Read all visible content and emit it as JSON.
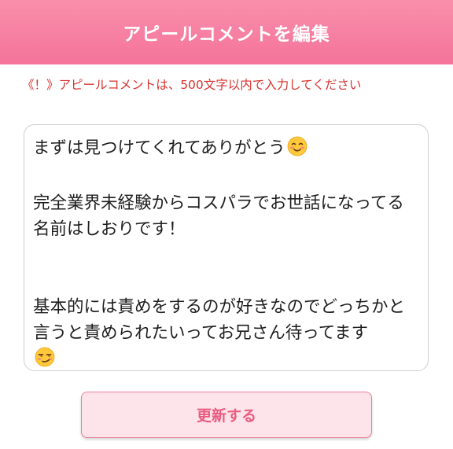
{
  "header": {
    "title": "アピールコメントを編集"
  },
  "notice": {
    "text": "《！》アピールコメントは、500文字以内で入力してください"
  },
  "comment": {
    "line1": "まずは見つけてくれてありがとう",
    "line1_emoji": "smiling-face-with-blush",
    "paragraph2": "完全業界未経験からコスパラでお世話になってる名前はしおりです！",
    "paragraph3": "基本的には責めをするのが好きなのでどっちかと言うと責められたいってお兄さん待ってます",
    "final_emoji": "smirking-face"
  },
  "button": {
    "update_label": "更新する"
  },
  "colors": {
    "header_top": "#f98fab",
    "header_bottom": "#f4739a",
    "notice_text": "#d8322f",
    "button_bg": "#fde4ea",
    "button_text": "#ea5b7f"
  }
}
